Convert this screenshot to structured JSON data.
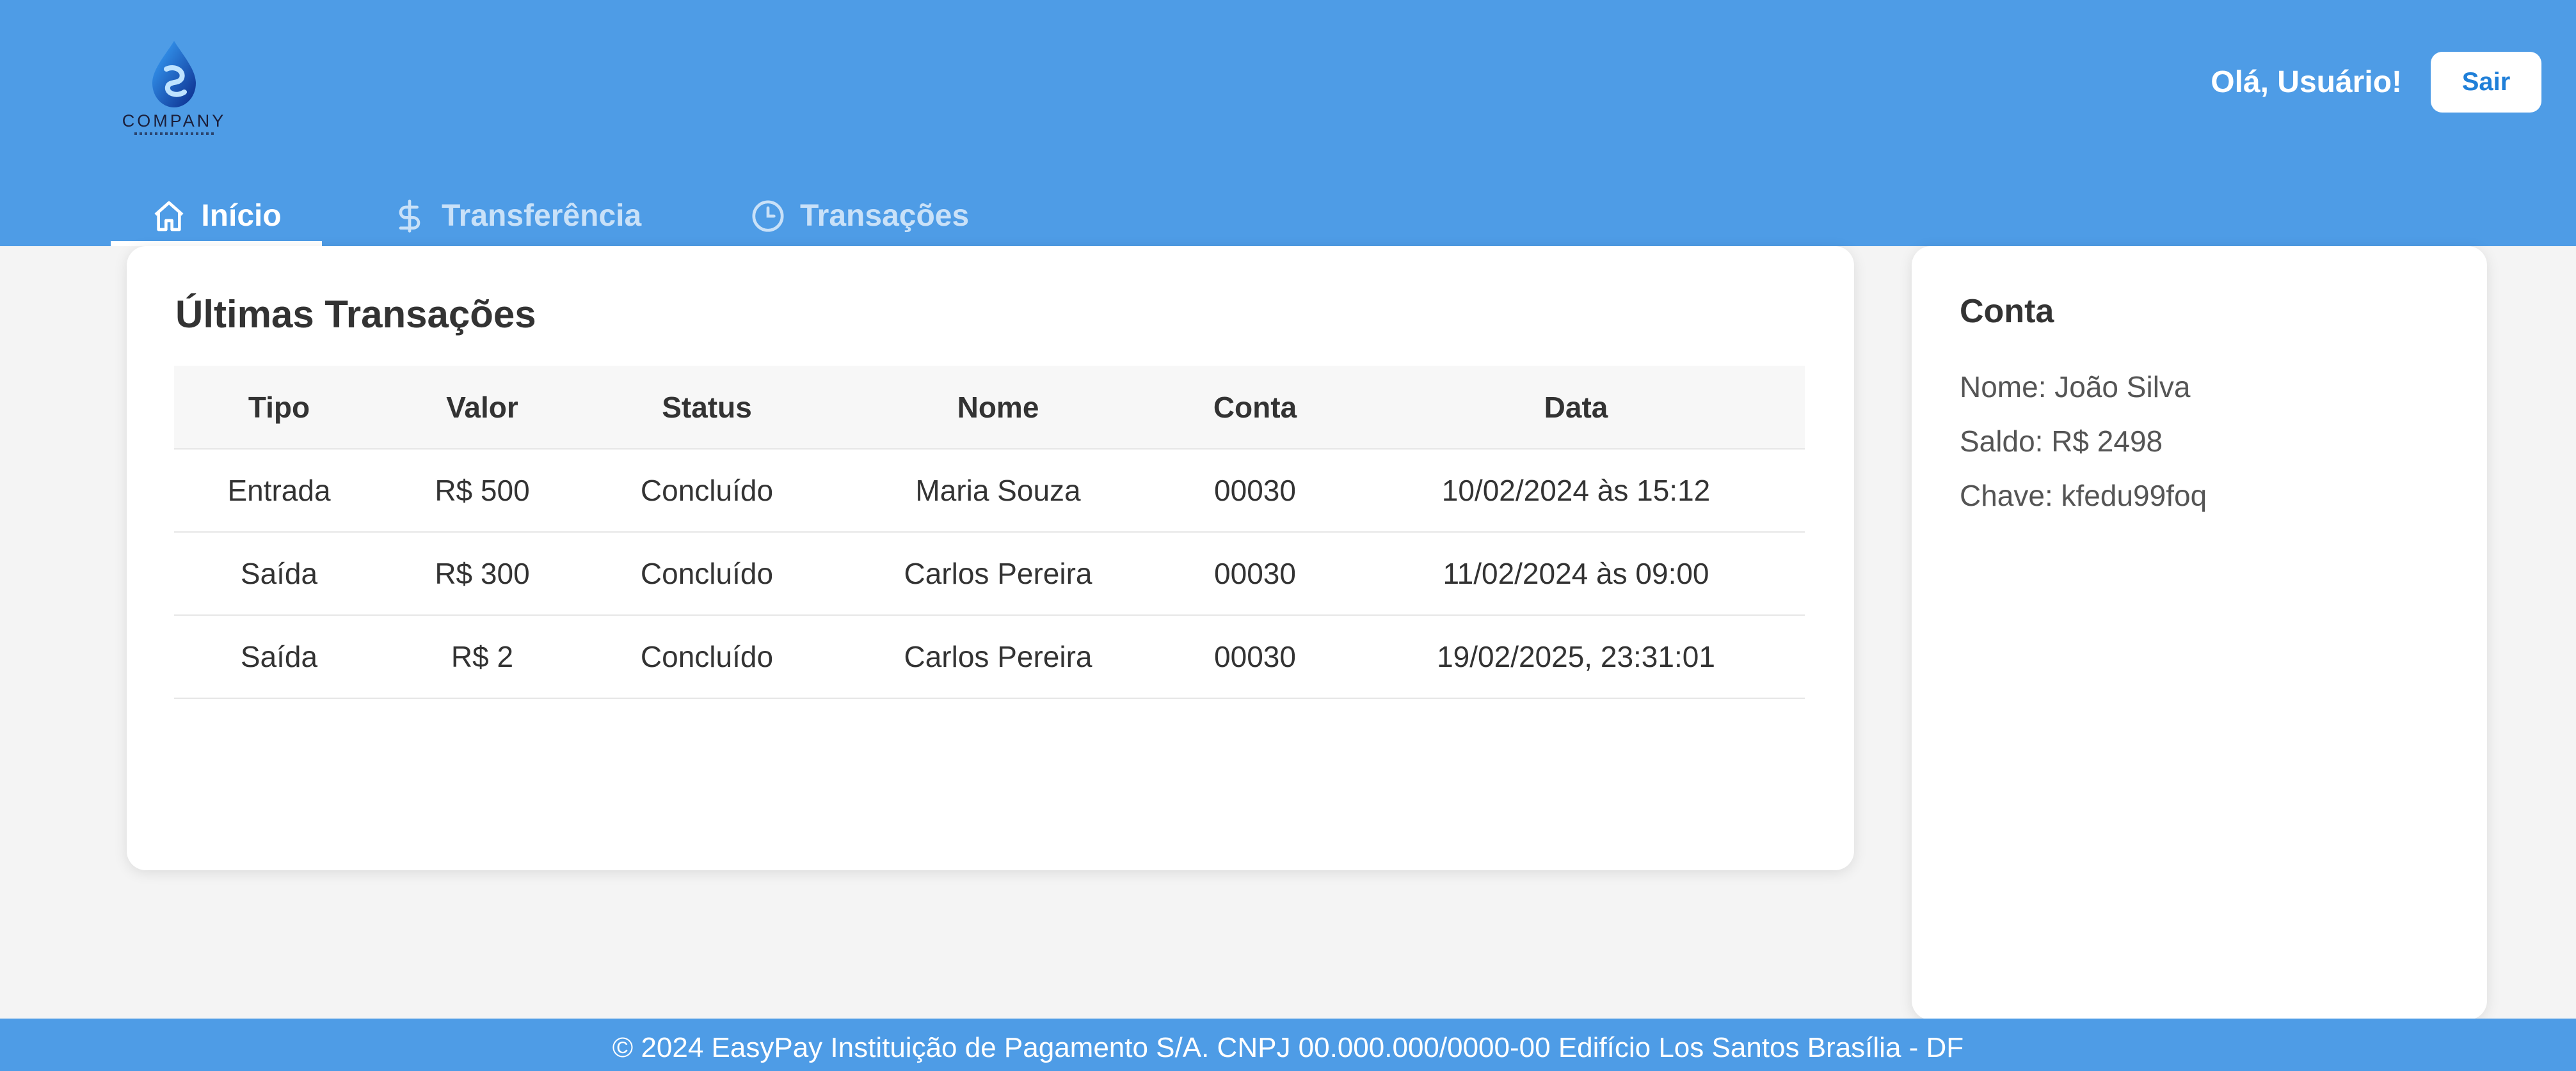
{
  "header": {
    "logo_text": "COMPANY",
    "greeting": "Olá, Usuário!",
    "logout_label": "Sair",
    "background_color": "#4e9ce6"
  },
  "tabs": [
    {
      "label": "Início",
      "icon": "home-icon",
      "active": true
    },
    {
      "label": "Transferência",
      "icon": "dollar-icon",
      "active": false
    },
    {
      "label": "Transações",
      "icon": "clock-icon",
      "active": false
    }
  ],
  "transactions": {
    "title": "Últimas Transações",
    "columns": [
      "Tipo",
      "Valor",
      "Status",
      "Nome",
      "Conta",
      "Data"
    ],
    "rows": [
      [
        "Entrada",
        "R$ 500",
        "Concluído",
        "Maria Souza",
        "00030",
        "10/02/2024 às 15:12"
      ],
      [
        "Saída",
        "R$ 300",
        "Concluído",
        "Carlos Pereira",
        "00030",
        "11/02/2024 às 09:00"
      ],
      [
        "Saída",
        "R$ 2",
        "Concluído",
        "Carlos Pereira",
        "00030",
        "19/02/2025, 23:31:01"
      ]
    ]
  },
  "account": {
    "title": "Conta",
    "name": "Nome: João Silva",
    "balance": "Saldo: R$ 2498",
    "key": "Chave: kfedu99foq"
  },
  "footer": {
    "text": "© 2024 EasyPay Instituição de Pagamento S/A. CNPJ 00.000.000/0000-00 Edifício Los Santos Brasília - DF"
  }
}
